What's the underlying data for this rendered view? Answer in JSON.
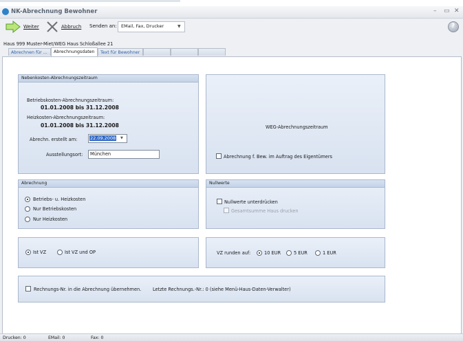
{
  "window": {
    "title": "NK-Abrechnung Bewohner"
  },
  "toolbar": {
    "weiter_label": "Weiter",
    "abbruch_label": "Abbruch",
    "senden_label": "Senden an:",
    "senden_value": "EMail, Fax, Drucker"
  },
  "address": "Haus 999  Muster-Miet/WEG Haus Schloßallee 21",
  "tabs": [
    {
      "label": "Abrechnen für ..."
    },
    {
      "label": "Abrechnungsdaten"
    },
    {
      "label": "Text für Bewohner"
    },
    {
      "label": ""
    },
    {
      "label": ""
    },
    {
      "label": ""
    }
  ],
  "nebenkosten": {
    "title": "Nebenkosten-Abrechnungszeitraum",
    "betrieb_label": "Betriebskosten-Abrechnungszeitraum:",
    "betrieb_value": "01.01.2008 bis 31.12.2008",
    "heiz_label": "Heizkosten-Abrechnungszeitraum:",
    "heiz_value": "01.01.2008 bis 31.12.2008",
    "erstellt_label": "Abrechn. erstellt am:",
    "erstellt_value": "22.09.2008",
    "ort_label": "Ausstellungsort:",
    "ort_value": "München"
  },
  "weg": {
    "title": "WEG-Abrechnungszeitraum",
    "auftrag_label": "Abrechnung f. Bew. im Auftrag des Eigentümers"
  },
  "abrechnung": {
    "title": "Abrechnung",
    "options": [
      "Betriebs- u. Heizkosten",
      "Nur Betriebskosten",
      "Nur Heizkosten"
    ]
  },
  "nullwerte": {
    "title": "Nullwerte",
    "unterdruecken_label": "Nullwerte unterdrücken",
    "gesamtsumme_label": "Gesamtsumme Haus drucken"
  },
  "vz": {
    "ist_label": "Ist VZ",
    "ist_op_label": "Ist VZ und OP"
  },
  "runden": {
    "label": "VZ runden auf:",
    "options": [
      "10 EUR",
      "5 EUR",
      "1 EUR"
    ]
  },
  "rechnung": {
    "uebernehmen_label": "Rechnungs-Nr. in die Abrechnung übernehmen.",
    "letzte_text": "Letzte Rechnungs.-Nr.: 0  (siehe Menü-Haus-Daten-Verwalter)"
  },
  "status": {
    "drucken": "Drucken: 0",
    "email": "EMail: 0",
    "fax": "Fax: 0"
  }
}
